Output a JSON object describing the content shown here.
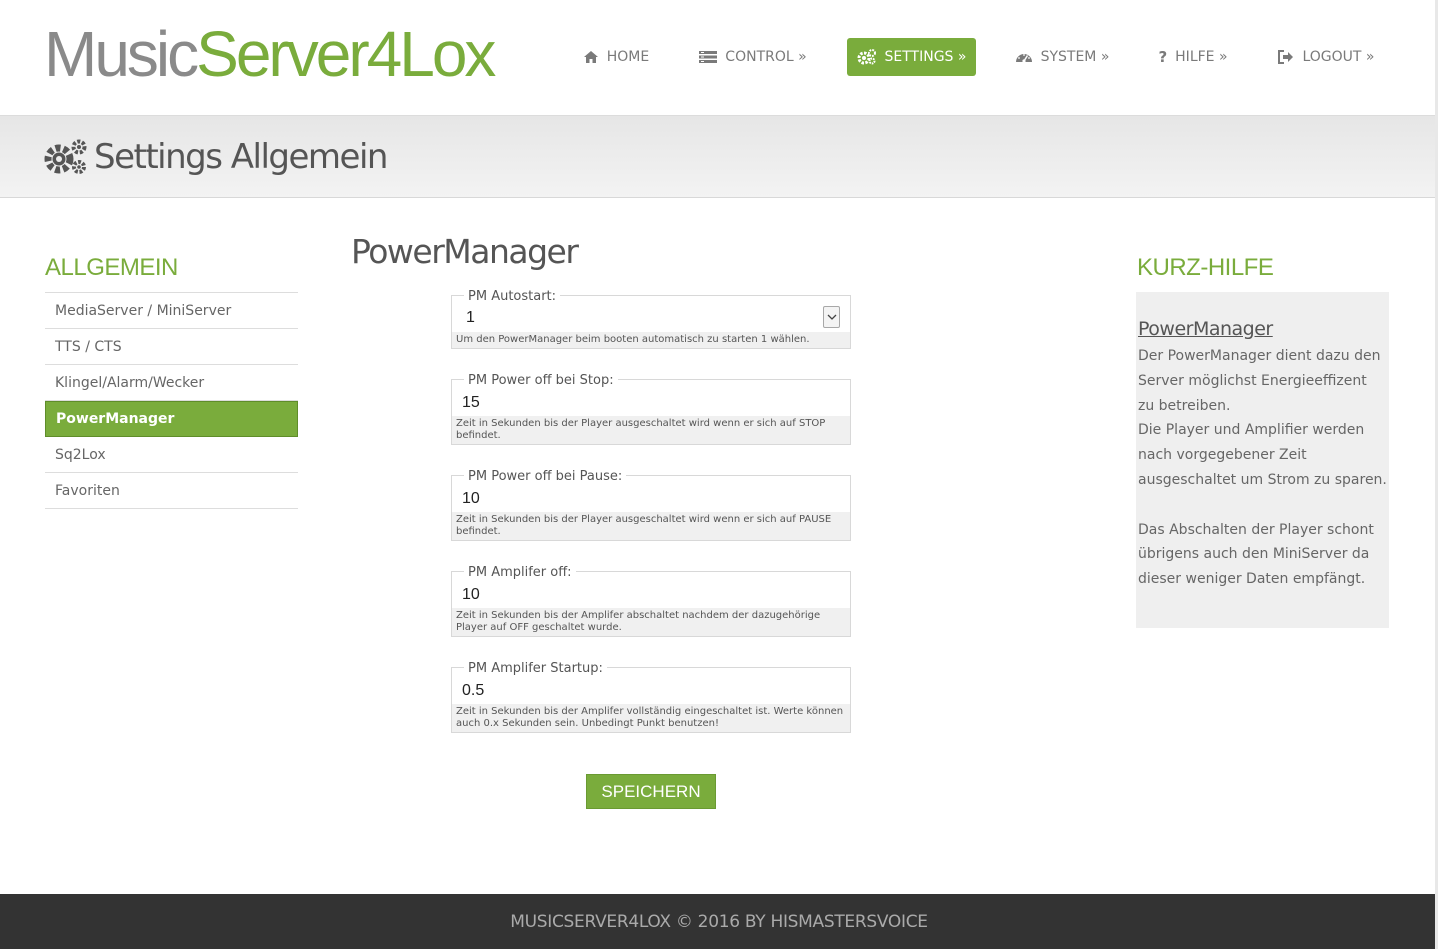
{
  "brand": {
    "part1": "Music",
    "part2": "Server4Lox",
    "color_gray": "#8a8a8a",
    "color_green": "#7aac3c"
  },
  "nav": [
    {
      "label": "Home",
      "icon": "home-icon",
      "active": false
    },
    {
      "label": "Control »",
      "icon": "list-icon",
      "active": false
    },
    {
      "label": "Settings »",
      "icon": "gears-icon",
      "active": true
    },
    {
      "label": "System »",
      "icon": "dashboard-icon",
      "active": false
    },
    {
      "label": "Hilfe »",
      "icon": "question-icon",
      "active": false
    },
    {
      "label": "Logout »",
      "icon": "logout-icon",
      "active": false
    }
  ],
  "page": {
    "title": "Settings Allgemein",
    "icon": "gears-icon"
  },
  "sidebar": {
    "heading": "Allgemein",
    "items": [
      {
        "label": "MediaServer / MiniServer",
        "active": false
      },
      {
        "label": "TTS / CTS",
        "active": false
      },
      {
        "label": "Klingel/Alarm/Wecker",
        "active": false
      },
      {
        "label": "PowerManager",
        "active": true
      },
      {
        "label": "Sq2Lox",
        "active": false
      },
      {
        "label": "Favoriten",
        "active": false
      }
    ]
  },
  "main": {
    "section_title": "PowerManager",
    "fields": [
      {
        "label": "PM Autostart:",
        "type": "select",
        "value": "1",
        "hint": "Um den PowerManager beim booten automatisch zu starten 1 wählen."
      },
      {
        "label": "PM Power off bei Stop:",
        "type": "text",
        "value": "15",
        "hint": "Zeit in Sekunden bis der Player ausgeschaltet wird wenn er sich auf STOP befindet."
      },
      {
        "label": "PM Power off bei Pause:",
        "type": "text",
        "value": "10",
        "hint": "Zeit in Sekunden bis der Player ausgeschaltet wird wenn er sich auf PAUSE befindet."
      },
      {
        "label": "PM Amplifer off:",
        "type": "text",
        "value": "10",
        "hint": "Zeit in Sekunden bis der Amplifer abschaltet nachdem der dazugehörige Player auf OFF geschaltet wurde."
      },
      {
        "label": "PM Amplifer Startup:",
        "type": "text",
        "value": "0.5",
        "hint": "Zeit in Sekunden bis der Amplifer vollständig eingeschaltet ist. Werte können auch 0.x Sekunden sein. Unbedingt Punkt benutzen!"
      }
    ],
    "save_label": "SPEICHERN"
  },
  "help": {
    "heading": "Kurz-Hilfe",
    "title": "PowerManager",
    "paragraph1": "Der PowerManager dient dazu den Server möglichst Energieeffizent zu betreiben.",
    "paragraph2": "Die Player und Amplifier werden nach vorgegebener Zeit ausgeschaltet um Strom zu sparen.",
    "paragraph3": "Das Abschalten der Player schont übrigens auch den MiniServer da dieser weniger Daten empfängt."
  },
  "footer": {
    "text": "MusicServer4Lox © 2016 by HisMastersVoice"
  }
}
